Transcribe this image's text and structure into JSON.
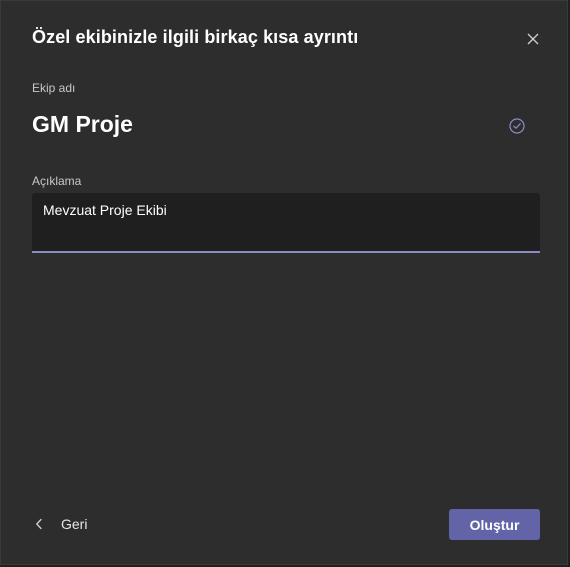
{
  "dialog": {
    "title": "Özel ekibinizle ilgili birkaç kısa ayrıntı",
    "close_icon": "close-icon"
  },
  "team_name": {
    "label": "Ekip adı",
    "value": "GM Proje",
    "status_icon": "check-circle-icon"
  },
  "description": {
    "label": "Açıklama",
    "value": "Mevzuat Proje Ekibi"
  },
  "footer": {
    "back_label": "Geri",
    "back_icon": "chevron-left-icon",
    "create_label": "Oluştur"
  },
  "colors": {
    "background": "#2d2d2d",
    "accent": "#6264a7",
    "input_underline": "#8b8cc7"
  }
}
